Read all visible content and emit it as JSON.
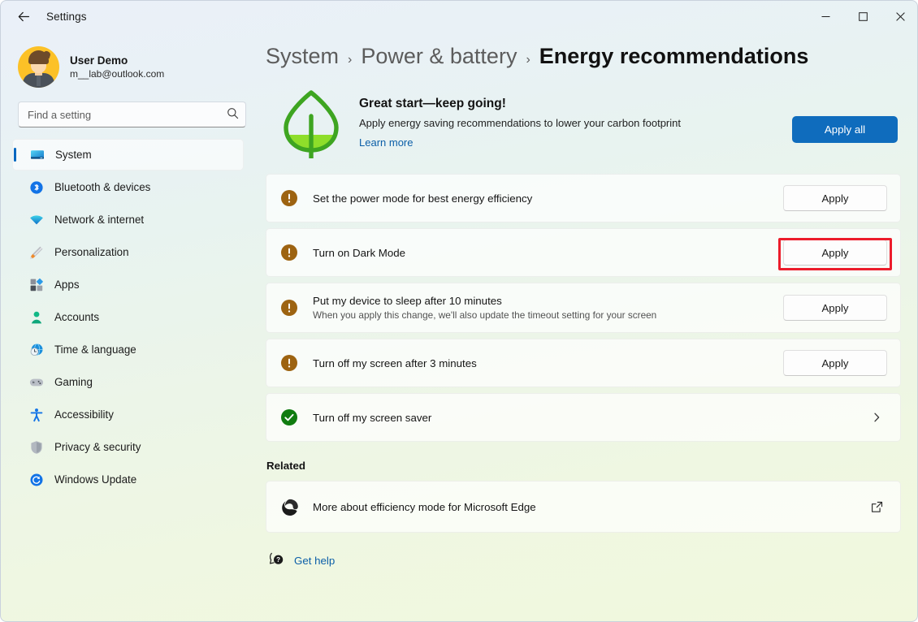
{
  "window": {
    "title": "Settings",
    "back_tooltip": "Back",
    "minimize": "─",
    "maximize": "☐",
    "close": "✕"
  },
  "sidebar": {
    "profile": {
      "name": "User Demo",
      "email": "m__lab@outlook.com"
    },
    "search": {
      "placeholder": "Find a setting",
      "value": "",
      "icon": "search-icon"
    },
    "items": [
      {
        "label": "System",
        "icon": "monitor-icon",
        "selected": true
      },
      {
        "label": "Bluetooth & devices",
        "icon": "bluetooth-icon",
        "selected": false
      },
      {
        "label": "Network & internet",
        "icon": "wifi-icon",
        "selected": false
      },
      {
        "label": "Personalization",
        "icon": "paintbrush-icon",
        "selected": false
      },
      {
        "label": "Apps",
        "icon": "apps-grid-icon",
        "selected": false
      },
      {
        "label": "Accounts",
        "icon": "person-icon",
        "selected": false
      },
      {
        "label": "Time & language",
        "icon": "clock-globe-icon",
        "selected": false
      },
      {
        "label": "Gaming",
        "icon": "gamepad-icon",
        "selected": false
      },
      {
        "label": "Accessibility",
        "icon": "accessibility-icon",
        "selected": false
      },
      {
        "label": "Privacy & security",
        "icon": "shield-icon",
        "selected": false
      },
      {
        "label": "Windows Update",
        "icon": "update-refresh-icon",
        "selected": false
      }
    ]
  },
  "main": {
    "breadcrumb": {
      "parent": "System",
      "middle": "Power & battery",
      "current": "Energy recommendations",
      "separator": "›"
    },
    "hero": {
      "icon": "leaf-icon",
      "title": "Great start—keep going!",
      "subtitle": "Apply energy saving recommendations to lower your carbon footprint",
      "link": "Learn more",
      "apply_all_label": "Apply all"
    },
    "recommendations": [
      {
        "title": "Set the power mode for best energy efficiency",
        "desc": "",
        "status": "pending",
        "icon": "warning-exclamation-icon",
        "action": "Apply",
        "action_type": "button",
        "highlighted": false
      },
      {
        "title": "Turn on Dark Mode",
        "desc": "",
        "status": "pending",
        "icon": "warning-exclamation-icon",
        "action": "Apply",
        "action_type": "button",
        "highlighted": true
      },
      {
        "title": "Put my device to sleep after 10 minutes",
        "desc": "When you apply this change, we'll also update the timeout setting for your screen",
        "status": "pending",
        "icon": "warning-exclamation-icon",
        "action": "Apply",
        "action_type": "button",
        "highlighted": false
      },
      {
        "title": "Turn off my screen after 3 minutes",
        "desc": "",
        "status": "pending",
        "icon": "warning-exclamation-icon",
        "action": "Apply",
        "action_type": "button",
        "highlighted": false
      },
      {
        "title": "Turn off my screen saver",
        "desc": "",
        "status": "done",
        "icon": "check-circle-icon",
        "action": "›",
        "action_type": "chevron",
        "highlighted": false
      }
    ],
    "related": {
      "heading": "Related",
      "item_label": "More about efficiency mode for Microsoft Edge",
      "item_icon": "edge-icon",
      "external_icon": "external-link-icon"
    },
    "get_help": {
      "label": "Get help",
      "icon": "help-question-icon"
    }
  },
  "colors": {
    "accent": "#0f6cbd",
    "link": "#0b5ea8",
    "highlight": "#ec1c2b",
    "warning": "#9d6311",
    "success": "#107c10",
    "selection_bar": "#0067c0"
  }
}
